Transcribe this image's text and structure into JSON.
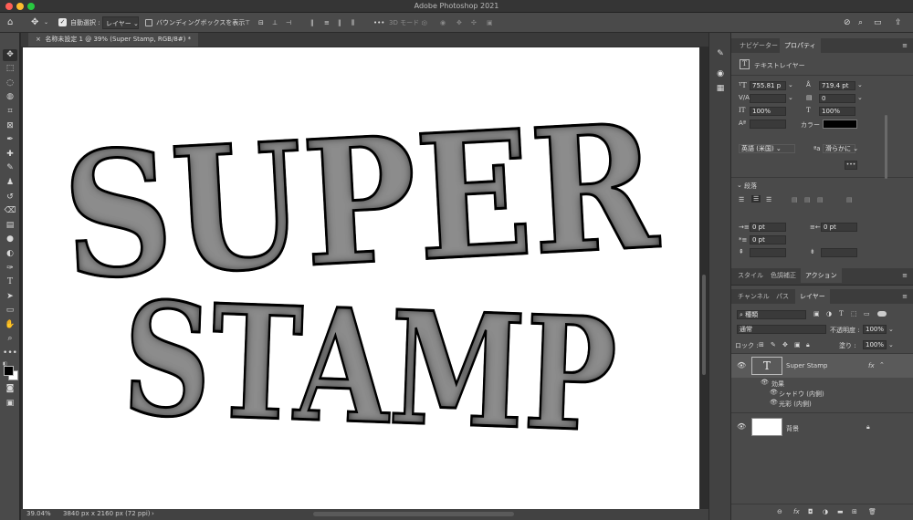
{
  "window": {
    "title": "Adobe Photoshop 2021"
  },
  "options_bar": {
    "auto_select_label": "自動選択 :",
    "auto_select_value": "レイヤー",
    "bbox_label": "バウンディングボックスを表示",
    "mode_3d": "3D モード :"
  },
  "document": {
    "tab_label": "名称未設定 1 @ 39% (Super Stamp, RGB/8#) *",
    "zoom": "39.04%",
    "size_info": "3840 px x 2160 px (72 ppi)",
    "canvas_text_line1": "SUPER",
    "canvas_text_line2": "STAMP"
  },
  "properties_panel": {
    "tabs": [
      "ナビゲーター",
      "プロパティ"
    ],
    "layer_kind": "テキストレイヤー",
    "font_size": "755.81 p",
    "leading": "719.4 pt",
    "tracking": "0",
    "vscale": "100%",
    "hscale": "100%",
    "color_label": "カラー :",
    "color_value": "#000000",
    "language": "英語 (米国)",
    "antialias": "滑らかに",
    "more": "•••",
    "paragraph_label": "段落",
    "indent_left": "0 pt",
    "indent_right": "0 pt",
    "indent_first": "0 pt"
  },
  "actions_tabs": [
    "スタイル",
    "色調補正",
    "アクション"
  ],
  "layers_panel": {
    "tabs": [
      "チャンネル",
      "パス",
      "レイヤー"
    ],
    "filter": "種類",
    "blend_mode": "通常",
    "opacity_label": "不透明度 :",
    "opacity": "100%",
    "lock_label": "ロック :",
    "fill_label": "塗り :",
    "fill": "100%",
    "layers": [
      {
        "name": "Super Stamp",
        "kind": "text",
        "fx": "fx"
      },
      {
        "name": "背景",
        "kind": "background"
      }
    ],
    "effects_label": "効果",
    "effects": [
      "シャドウ (内側)",
      "光彩 (内側)"
    ]
  },
  "colors": {
    "foreground": "#000000",
    "background": "#ffffff",
    "accent": "#1473e6"
  }
}
